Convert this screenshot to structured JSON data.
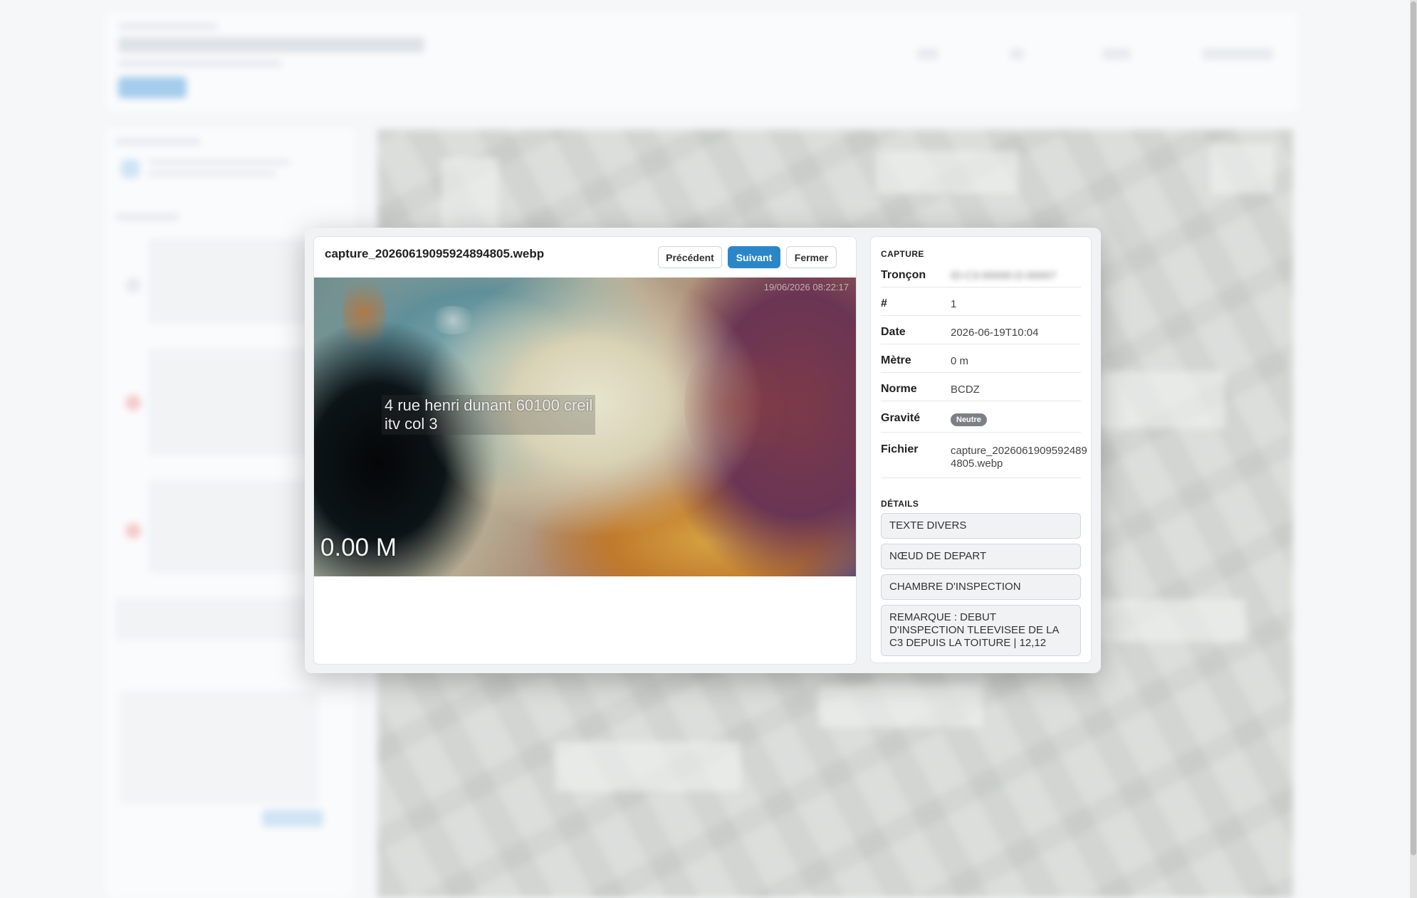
{
  "modal": {
    "filename": "capture_20260619095924894805.webp",
    "buttons": {
      "previous": "Précédent",
      "next": "Suivant",
      "close": "Fermer"
    },
    "image_overlay": {
      "address_line1": "4 rue henri dunant 60100 creil",
      "address_line2": "itv col 3",
      "meter": "0.00 M",
      "timestamp": "19/06/2026 08:22:17"
    }
  },
  "info": {
    "capture_title": "CAPTURE",
    "fields": {
      "troncon_label": "Tronçon",
      "troncon_value": "ID-C3-00000-D-00007",
      "number_label": "#",
      "number_value": "1",
      "date_label": "Date",
      "date_value": "2026-06-19T10:04",
      "metre_label": "Mètre",
      "metre_value": "0 m",
      "norme_label": "Norme",
      "norme_value": "BCDZ",
      "gravite_label": "Gravité",
      "gravite_value": "Neutre",
      "fichier_label": "Fichier",
      "fichier_value": "capture_20260619095924894805.webp"
    },
    "details_title": "DÉTAILS",
    "details": [
      "TEXTE DIVERS",
      "NŒUD DE DEPART",
      "CHAMBRE D'INSPECTION",
      "REMARQUE : DEBUT D'INSPECTION TLEEVISEE DE LA C3 DEPUIS LA TOITURE | 12,12"
    ]
  },
  "colors": {
    "accent": "#2b86c9",
    "badge": "#7d8186",
    "modal_bg": "#f1f2f4"
  }
}
